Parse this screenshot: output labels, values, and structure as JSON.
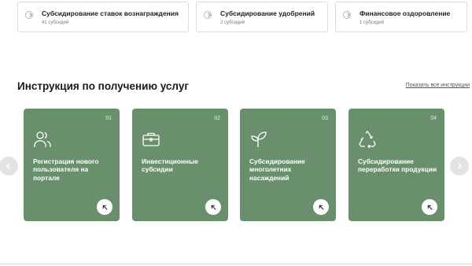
{
  "categories": [
    {
      "title": "Субсидирование ставок вознаграждения",
      "count": "41 субсидий"
    },
    {
      "title": "Субсидирование удобрений",
      "count": "2 субсидий"
    },
    {
      "title": "Финансовое оздоровление",
      "count": "1 субсидий"
    }
  ],
  "instructions": {
    "title": "Инструкция по получению услуг",
    "show_all": "Показать все инструкции",
    "cards": [
      {
        "number": "01",
        "label": "Регистрация нового пользователя на портале",
        "icon": "users-icon"
      },
      {
        "number": "02",
        "label": "Инвестиционные субсидии",
        "icon": "briefcase-icon"
      },
      {
        "number": "03",
        "label": "Субсидирование многолетних насаждений",
        "icon": "sprout-icon"
      },
      {
        "number": "04",
        "label": "Субсидирование переработки продукции",
        "icon": "recycle-icon"
      }
    ]
  },
  "colors": {
    "card_bg": "#6a8f6d",
    "nav_bg": "#e3e3e3"
  }
}
